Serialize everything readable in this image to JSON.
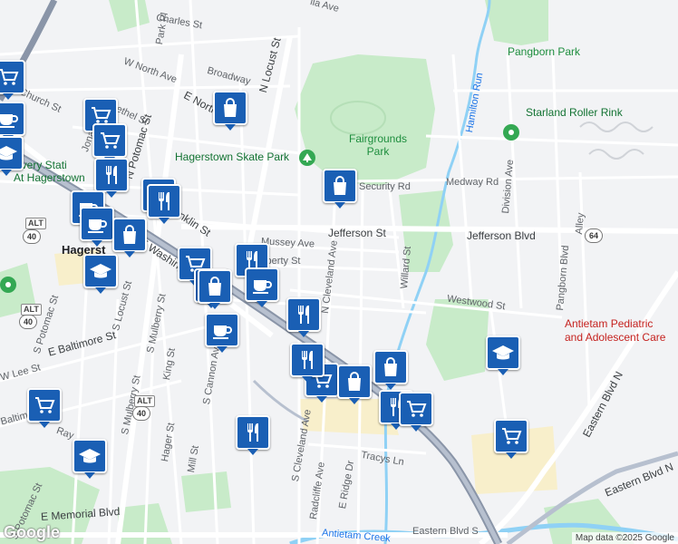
{
  "streets": {
    "charles_st": "Charles St",
    "park_pl": "Park Pl",
    "broadway": "Broadway",
    "w_north_ave": "W North Ave",
    "e_north_ave": "E North Ave",
    "n_locust_st": "N Locust St",
    "n_potomac_st": "N Potomac St",
    "church_st": "Church St",
    "bethel_st": "Bethel St",
    "jonathan_st": "Jonathan St",
    "n_cleveland_ave": "N Cleveland Ave",
    "mussey_ave": "Mussey Ave",
    "liberty_st": "Liberty St",
    "jefferson_st": "Jefferson St",
    "jefferson_blvd": "Jefferson Blvd",
    "security_rd": "Security Rd",
    "medway_rd": "Medway Rd",
    "division_ave": "Division Ave",
    "willard_st": "Willard St",
    "westwood_st": "Westwood St",
    "pangborn_blvd": "Pangborn Blvd",
    "alley": "Alley",
    "eastern_blvd_n": "Eastern Blvd N",
    "eastern_blvd_s": "Eastern Blvd S",
    "e_washington_st": "E Washington St",
    "e_franklin_st": "E Franklin St",
    "s_potomac_st": "S Potomac St",
    "s_locust_st": "S Locust St",
    "s_mulberry_st": "S Mulberry St",
    "e_baltimore_st": "E Baltimore St",
    "w_lee_st": "W Lee St",
    "baltimore_st": "Baltimore St",
    "king_st": "King St",
    "hager_st": "Hager St",
    "mill_st": "Mill St",
    "s_cannon_ave": "S Cannon Ave",
    "s_cleveland_ave": "S Cleveland Ave",
    "radcliffe_ave": "Radcliffe Ave",
    "e_ridge_dr": "E Ridge Dr",
    "tracys_ln": "Tracys Ln",
    "e_memorial_blvd": "E Memorial Blvd",
    "potomac_st": "S Potomac St",
    "ray_st": "Ray",
    "oak_hill_ave": "ila Ave"
  },
  "places": {
    "pangborn_park": "Pangborn Park",
    "starland_roller_rink": "Starland Roller Rink",
    "fairgrounds_park": "Fairgrounds\nPark",
    "hagerstown_skate_park": "Hagerstown Skate Park",
    "antietam_pediatric_line1": "Antietam Pediatric",
    "antietam_pediatric_line2": "and Adolescent Care",
    "discovery_station_line1": "scovery Stati",
    "discovery_station_line2": "At Hagerstown",
    "hagerstown": "Hagerst",
    "hamilton_run": "Hamilton Run",
    "antietam_creek": "Antietam Creek"
  },
  "shields": {
    "alt40_a": "ALT",
    "alt40_a_num": "40",
    "alt40_b": "ALT",
    "alt40_b_num": "40",
    "alt40_c": "ALT",
    "alt40_c_num": "40",
    "us64": "64"
  },
  "markers": [
    {
      "type": "grocery"
    },
    {
      "type": "coffee"
    },
    {
      "type": "school"
    },
    {
      "type": "grocery"
    },
    {
      "type": "grocery"
    },
    {
      "type": "shopping"
    },
    {
      "type": "restaurant"
    },
    {
      "type": "coffee"
    },
    {
      "type": "shopping"
    },
    {
      "type": "restaurant"
    },
    {
      "type": "school"
    },
    {
      "type": "coffee"
    },
    {
      "type": "restaurant"
    },
    {
      "type": "grocery"
    },
    {
      "type": "shopping"
    },
    {
      "type": "coffee"
    },
    {
      "type": "restaurant"
    },
    {
      "type": "coffee"
    },
    {
      "type": "restaurant"
    },
    {
      "type": "shopping"
    },
    {
      "type": "shopping"
    },
    {
      "type": "grocery"
    },
    {
      "type": "shopping"
    },
    {
      "type": "restaurant"
    },
    {
      "type": "restaurant"
    },
    {
      "type": "grocery"
    },
    {
      "type": "school"
    },
    {
      "type": "grocery"
    },
    {
      "type": "school"
    },
    {
      "type": "shopping"
    },
    {
      "type": "restaurant"
    },
    {
      "type": "grocery"
    }
  ],
  "colors": {
    "marker_fill": "#1a5fb4",
    "park": "#c8ebc9",
    "water": "#8fd1f5",
    "highway": "#9aa6b8",
    "road": "#ffffff",
    "commercial": "#f8efcb"
  },
  "footer": {
    "google_logo": "Google",
    "attribution": "Map data ©2025 Google"
  }
}
